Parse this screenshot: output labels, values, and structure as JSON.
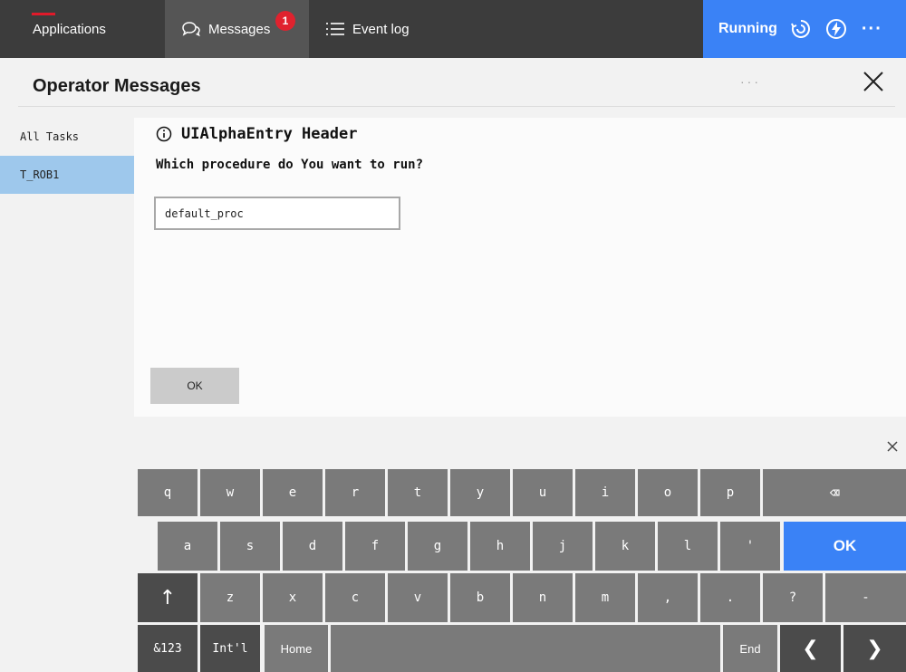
{
  "topbar": {
    "applications_label": "Applications",
    "messages_label": "Messages",
    "messages_badge": "1",
    "eventlog_label": "Event log",
    "status_label": "Running",
    "more_label": "···",
    "colors": {
      "bar": "#3c3c3c",
      "active_tab": "#555555",
      "status": "#3a82f6",
      "badge": "#e0222e"
    }
  },
  "window": {
    "title": "Operator Messages",
    "dots": "···"
  },
  "tasks": {
    "items": [
      {
        "label": "All Tasks",
        "selected": false
      },
      {
        "label": "T_ROB1",
        "selected": true
      }
    ]
  },
  "message": {
    "header": "UIAlphaEntry Header",
    "question": "Which procedure do You want to run?",
    "input_value": "default_proc",
    "ok_label": "OK"
  },
  "keyboard": {
    "row1": [
      "q",
      "w",
      "e",
      "r",
      "t",
      "y",
      "u",
      "i",
      "o",
      "p"
    ],
    "backspace_label": "⌫",
    "row2": [
      "a",
      "s",
      "d",
      "f",
      "g",
      "h",
      "j",
      "k",
      "l",
      "'"
    ],
    "ok_label": "OK",
    "row3": [
      "z",
      "x",
      "c",
      "v",
      "b",
      "n",
      "m",
      ",",
      ".",
      "?",
      "-"
    ],
    "shift_label": "↑",
    "sym_label": "&123",
    "intl_label": "Int'l",
    "home_label": "Home",
    "end_label": "End",
    "left_label": "❮",
    "right_label": "❯"
  }
}
